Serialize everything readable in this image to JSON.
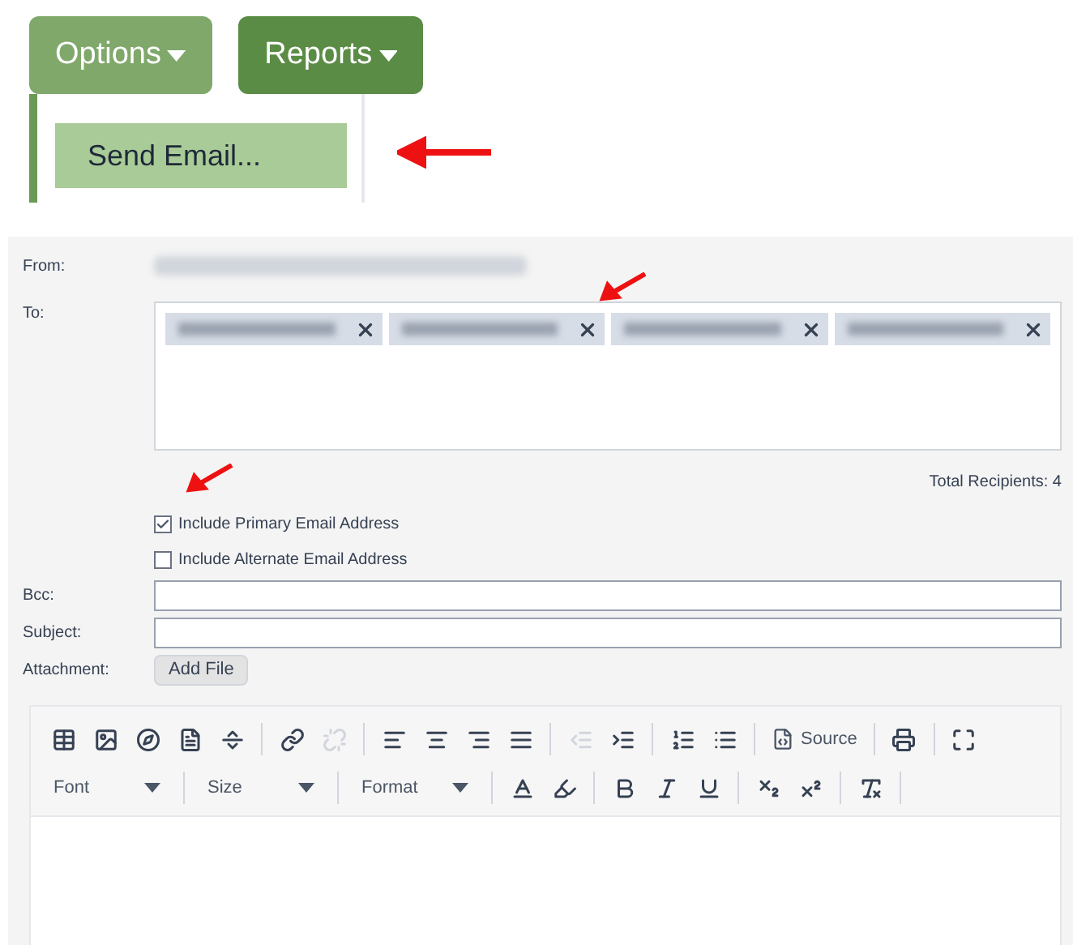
{
  "menus": [
    {
      "label": "Options",
      "expanded": true
    },
    {
      "label": "Reports",
      "expanded": false
    }
  ],
  "dropdown": {
    "items": [
      {
        "label": "Send Email...",
        "selected": true
      }
    ]
  },
  "form": {
    "from_label": "From:",
    "to_label": "To:",
    "recipients": [
      {
        "blurred": true
      },
      {
        "blurred": true
      },
      {
        "blurred": true
      },
      {
        "blurred": true
      }
    ],
    "total": "Total Recipients: 4",
    "checkboxes": [
      {
        "label": "Include Primary Email Address",
        "checked": true
      },
      {
        "label": "Include Alternate Email Address",
        "checked": false
      }
    ],
    "bcc_label": "Bcc:",
    "subject_label": "Subject:",
    "attachment_label": "Attachment:",
    "add_file": "Add File"
  },
  "toolbar": {
    "row_1": [
      {
        "kind": "table",
        "disabled": false
      },
      {
        "kind": "image",
        "disabled": false
      },
      {
        "kind": "flash",
        "disabled": false
      },
      {
        "kind": "page",
        "disabled": false
      },
      {
        "kind": "rule",
        "disabled": false
      },
      {
        "kind": "sep"
      },
      {
        "kind": "link",
        "disabled": false
      },
      {
        "kind": "unlink",
        "disabled": true
      },
      {
        "kind": "sep"
      },
      {
        "kind": "align-left",
        "disabled": false
      },
      {
        "kind": "align-center",
        "disabled": false
      },
      {
        "kind": "align-right",
        "disabled": false
      },
      {
        "kind": "justify",
        "disabled": false
      },
      {
        "kind": "sep"
      },
      {
        "kind": "outdent",
        "disabled": true
      },
      {
        "kind": "indent",
        "disabled": false
      },
      {
        "kind": "sep"
      },
      {
        "kind": "numbered",
        "disabled": false
      },
      {
        "kind": "bulleted",
        "disabled": false
      },
      {
        "kind": "sep"
      },
      {
        "kind": "source",
        "label": "Source",
        "disabled": false
      },
      {
        "kind": "sep"
      },
      {
        "kind": "print",
        "disabled": false
      },
      {
        "kind": "sep"
      },
      {
        "kind": "maximize",
        "disabled": false
      }
    ],
    "row_2": [
      {
        "kind": "select",
        "label": "Font"
      },
      {
        "kind": "sep"
      },
      {
        "kind": "select",
        "label": "Size"
      },
      {
        "kind": "sep"
      },
      {
        "kind": "select",
        "label": "Format"
      },
      {
        "kind": "sep"
      },
      {
        "kind": "text-color",
        "disabled": false
      },
      {
        "kind": "bg-color",
        "disabled": false
      },
      {
        "kind": "sep"
      },
      {
        "kind": "bold",
        "disabled": false
      },
      {
        "kind": "italic",
        "disabled": false
      },
      {
        "kind": "underline",
        "disabled": false
      },
      {
        "kind": "sep"
      },
      {
        "kind": "subscript",
        "disabled": false
      },
      {
        "kind": "superscript",
        "disabled": false
      },
      {
        "kind": "sep"
      },
      {
        "kind": "clear-format",
        "disabled": false
      },
      {
        "kind": "sep"
      }
    ]
  }
}
